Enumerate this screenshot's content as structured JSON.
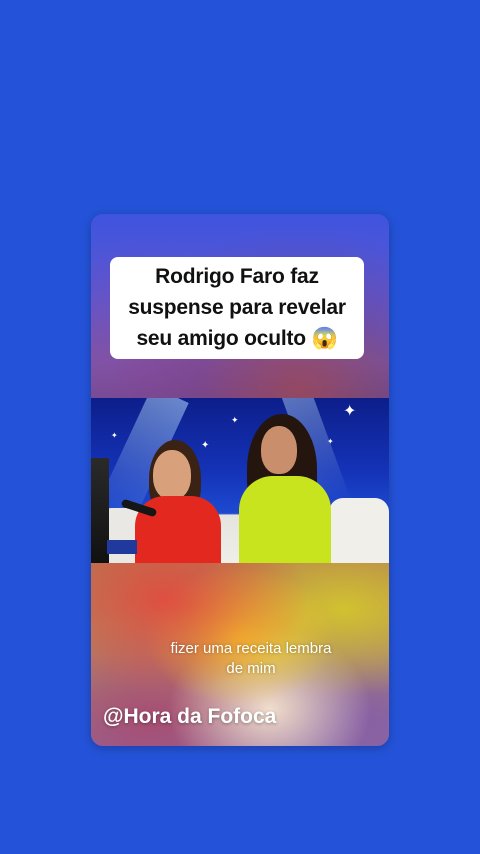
{
  "post": {
    "title_line1": "Rodrigo Faro faz",
    "title_line2": "suspense para revelar",
    "title_line3": "seu amigo oculto 😱",
    "subtitle_line1": "fizer uma receita lembra",
    "subtitle_line2": "de mim",
    "watermark": "@Hora da Fofoca"
  },
  "colors": {
    "background": "#2453d9",
    "caption_box": "#ffffff",
    "text_dark": "#111111",
    "text_light": "#ffffff"
  },
  "icons": {
    "stars": "sparkle-icon"
  }
}
